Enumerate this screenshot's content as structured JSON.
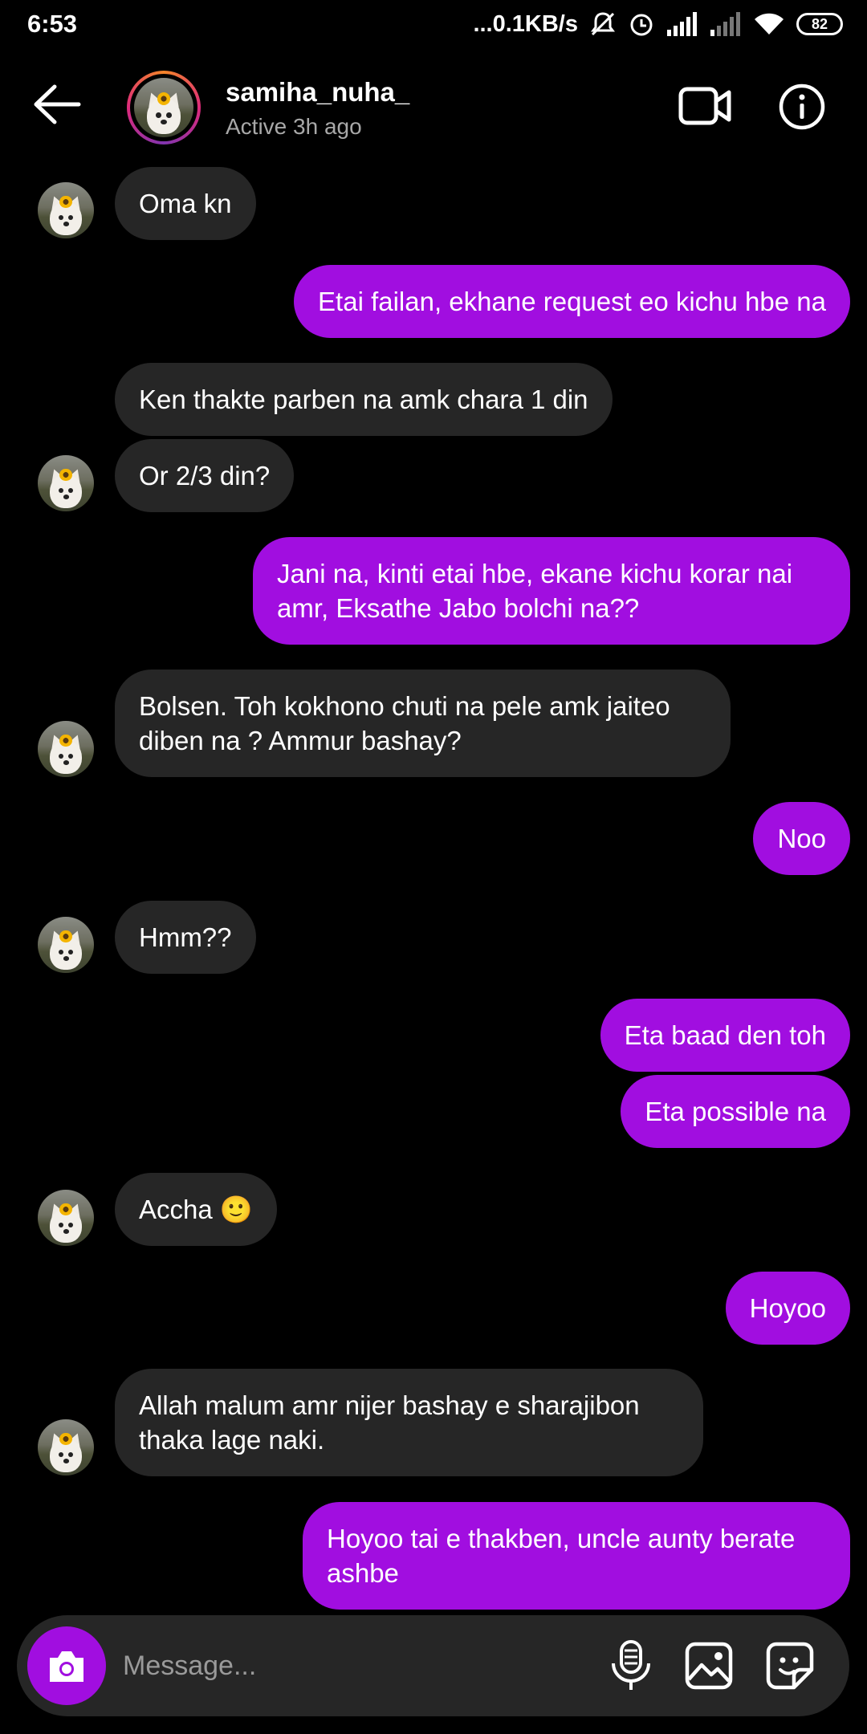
{
  "status_bar": {
    "time": "6:53",
    "net_speed": "...0.1KB/s",
    "battery": "82"
  },
  "header": {
    "username": "samiha_nuha_",
    "activity": "Active 3h ago"
  },
  "messages": [
    {
      "from": "them",
      "text": "Oma kn"
    },
    {
      "from": "me",
      "text": "Etai failan, ekhane request eo kichu hbe na"
    },
    {
      "from": "them",
      "text": "Ken thakte parben na amk chara 1 din"
    },
    {
      "from": "them",
      "text": "Or 2/3 din?"
    },
    {
      "from": "me",
      "text": "Jani na, kinti etai hbe, ekane kichu korar nai amr, Eksathe Jabo bolchi na??"
    },
    {
      "from": "them",
      "text": "Bolsen. Toh kokhono chuti na pele amk jaiteo diben na ? Ammur bashay?"
    },
    {
      "from": "me",
      "text": "Noo"
    },
    {
      "from": "them",
      "text": "Hmm??"
    },
    {
      "from": "me",
      "text": "Eta baad den toh"
    },
    {
      "from": "me",
      "text": "Eta possible na"
    },
    {
      "from": "them",
      "text": "Accha 🙂"
    },
    {
      "from": "me",
      "text": "Hoyoo"
    },
    {
      "from": "them",
      "text": "Allah malum amr nijer bashay e sharajibon thaka lage naki."
    },
    {
      "from": "me",
      "text": "Hoyoo tai e thakben, uncle aunty berate ashbe"
    }
  ],
  "composer": {
    "placeholder": "Message..."
  },
  "colors": {
    "outgoing_bubble": "#a10ee0",
    "incoming_bubble": "#262626",
    "background": "#000000"
  }
}
